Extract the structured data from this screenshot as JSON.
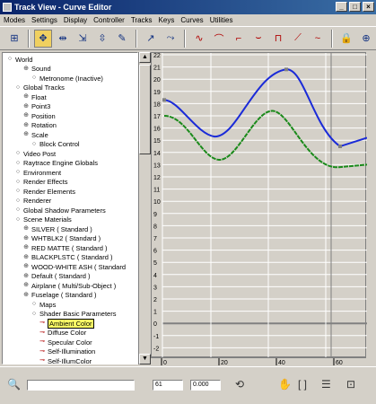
{
  "window": {
    "title": "Track View - Curve Editor"
  },
  "menu": [
    "Modes",
    "Settings",
    "Display",
    "Controller",
    "Tracks",
    "Keys",
    "Curves",
    "Utilities"
  ],
  "toolbar": {
    "tools": [
      "filters-icon",
      "move-keys-icon",
      "slide-keys-icon",
      "scale-keys-icon",
      "scale-values-icon",
      "insert-keys-icon",
      "draw-curves-icon",
      "reduce-keys-icon",
      "tangent-auto-icon",
      "tangent-custom-icon",
      "tangent-fast-icon",
      "tangent-slow-icon",
      "tangent-step-icon",
      "tangent-linear-icon",
      "tangent-smooth-icon",
      "lock-icon",
      "snap-icon"
    ]
  },
  "tree": [
    {
      "label": "World",
      "indent": 0
    },
    {
      "label": "Sound",
      "indent": 2
    },
    {
      "label": "Metronome (Inactive)",
      "indent": 3
    },
    {
      "label": "Global Tracks",
      "indent": 1
    },
    {
      "label": "Float",
      "indent": 2
    },
    {
      "label": "Point3",
      "indent": 2
    },
    {
      "label": "Position",
      "indent": 2
    },
    {
      "label": "Rotation",
      "indent": 2
    },
    {
      "label": "Scale",
      "indent": 2
    },
    {
      "label": "Block Control",
      "indent": 3
    },
    {
      "label": "Video Post",
      "indent": 1
    },
    {
      "label": "Raytrace Engine Globals",
      "indent": 1
    },
    {
      "label": "Environment",
      "indent": 1
    },
    {
      "label": "Render Effects",
      "indent": 1
    },
    {
      "label": "Render Elements",
      "indent": 1
    },
    {
      "label": "Renderer",
      "indent": 1
    },
    {
      "label": "Global Shadow Parameters",
      "indent": 1
    },
    {
      "label": "Scene Materials",
      "indent": 1
    },
    {
      "label": "SILVER ( Standard )",
      "indent": 2
    },
    {
      "label": "WHTBLK2 ( Standard )",
      "indent": 2
    },
    {
      "label": "RED MATTE ( Standard )",
      "indent": 2
    },
    {
      "label": "BLACKPLSTC ( Standard )",
      "indent": 2
    },
    {
      "label": "WOOD-WHITE ASH ( Standard",
      "indent": 2
    },
    {
      "label": "Default ( Standard )",
      "indent": 2
    },
    {
      "label": "Airplane ( Multi/Sub-Object )",
      "indent": 2
    },
    {
      "label": "Fuselage ( Standard )",
      "indent": 2
    },
    {
      "label": "Maps",
      "indent": 3
    },
    {
      "label": "Shader Basic Parameters",
      "indent": 3
    },
    {
      "label": "Ambient Color",
      "indent": 4
    },
    {
      "label": "Diffuse Color",
      "indent": 4
    },
    {
      "label": "Specular Color",
      "indent": 4
    },
    {
      "label": "Self-Illumination",
      "indent": 4
    },
    {
      "label": "Self-IllumColor",
      "indent": 4
    }
  ],
  "plot": {
    "y_ticks": [
      "22",
      "21",
      "20",
      "19",
      "18",
      "17",
      "16",
      "15",
      "14",
      "13",
      "12",
      "11",
      "10",
      "9",
      "8",
      "7",
      "6",
      "5",
      "4",
      "3",
      "2",
      "1",
      "0",
      "-1",
      "-2"
    ],
    "x_ticks": [
      "0",
      "20",
      "40",
      "60"
    ],
    "colors": {
      "blue": "#1a2ad8",
      "green": "#1a8a1a",
      "grid": "#ffffff",
      "bg": "#d4d0c8"
    }
  },
  "status": {
    "frame_field": "61",
    "value_field": "0.000"
  }
}
